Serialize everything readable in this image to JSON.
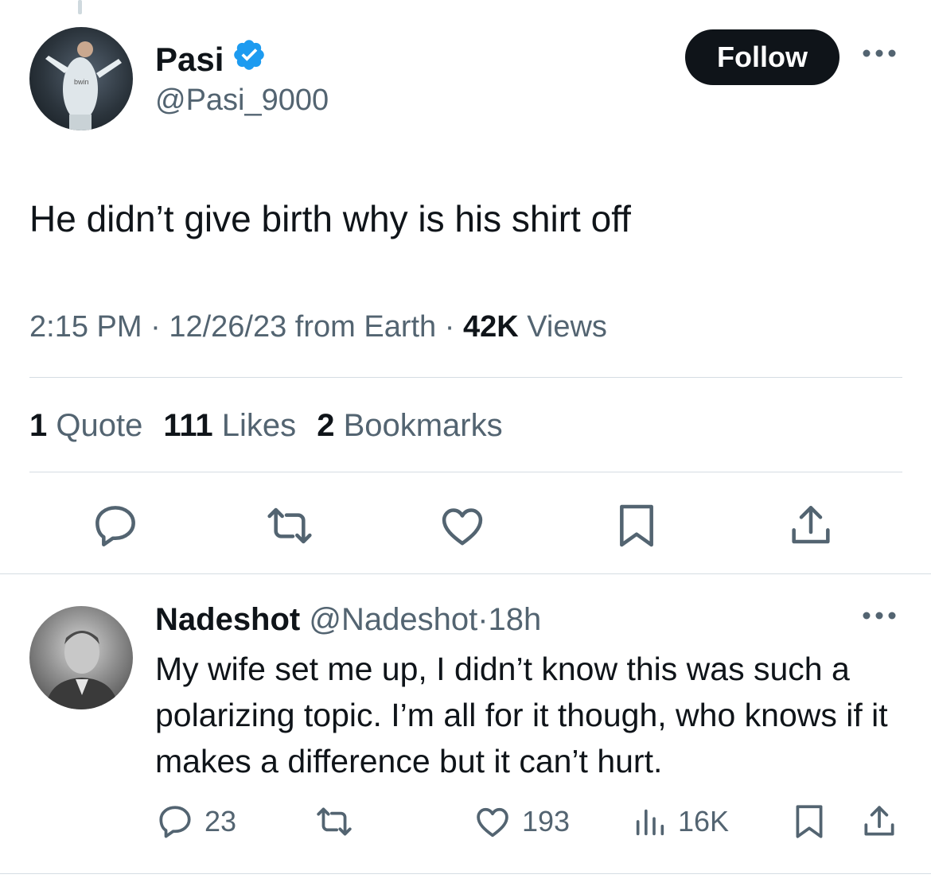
{
  "tweet": {
    "author_name": "Pasi",
    "author_handle": "@Pasi_9000",
    "follow_label": "Follow",
    "text": "He didn’t give birth why is his shirt off",
    "time": "2:15 PM",
    "sep1": "·",
    "date": "12/26/23",
    "source": "from Earth",
    "sep2": "·",
    "views_count": "42K",
    "views_label": "Views",
    "stats": {
      "quotes_count": "1",
      "quotes_label": "Quote",
      "likes_count": "111",
      "likes_label": "Likes",
      "bookmarks_count": "2",
      "bookmarks_label": "Bookmarks"
    },
    "actions": [
      "reply-icon",
      "retweet-icon",
      "like-icon",
      "bookmark-icon",
      "share-icon"
    ]
  },
  "reply": {
    "author_name": "Nadeshot",
    "author_handle": "@Nadeshot",
    "sep": "·",
    "age": "18h",
    "text": "My wife set me up, I didn’t know this was such a polarizing topic. I’m all for it though, who knows if it makes a difference but it can’t hurt.",
    "reply_count": "23",
    "like_count": "193",
    "view_count": "16K"
  },
  "colors": {
    "text": "#0f1419",
    "muted": "#536471",
    "verified": "#1d9bf0",
    "divider": "#d5dde3",
    "button_bg": "#0f1419"
  }
}
